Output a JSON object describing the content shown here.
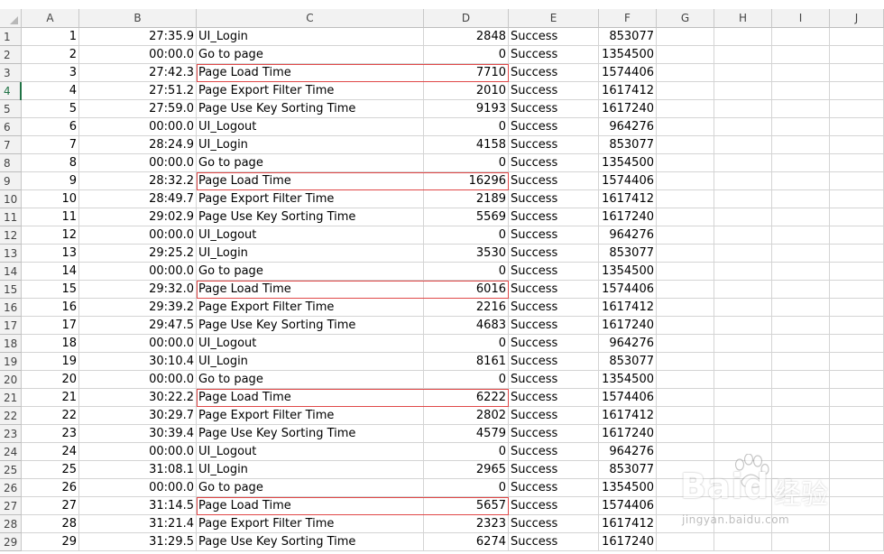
{
  "columns": [
    "A",
    "B",
    "C",
    "D",
    "E",
    "F",
    "G",
    "H",
    "I",
    "J"
  ],
  "rows": [
    {
      "n": "1",
      "a": "1",
      "b": "27:35.9",
      "c": "UI_Login",
      "d": "2848",
      "e": "Success",
      "f": "853077"
    },
    {
      "n": "2",
      "a": "2",
      "b": "00:00.0",
      "c": "Go to page",
      "d": "0",
      "e": "Success",
      "f": "1354500"
    },
    {
      "n": "3",
      "a": "3",
      "b": "27:42.3",
      "c": "Page Load Time",
      "d": "7710",
      "e": "Success",
      "f": "1574406",
      "hl": true
    },
    {
      "n": "4",
      "a": "4",
      "b": "27:51.2",
      "c": "Page Export Filter Time",
      "d": "2010",
      "e": "Success",
      "f": "1617412",
      "active": true
    },
    {
      "n": "5",
      "a": "5",
      "b": "27:59.0",
      "c": "Page Use Key Sorting Time",
      "d": "9193",
      "e": "Success",
      "f": "1617240"
    },
    {
      "n": "6",
      "a": "6",
      "b": "00:00.0",
      "c": "UI_Logout",
      "d": "0",
      "e": "Success",
      "f": "964276"
    },
    {
      "n": "7",
      "a": "7",
      "b": "28:24.9",
      "c": "UI_Login",
      "d": "4158",
      "e": "Success",
      "f": "853077"
    },
    {
      "n": "8",
      "a": "8",
      "b": "00:00.0",
      "c": "Go to page",
      "d": "0",
      "e": "Success",
      "f": "1354500"
    },
    {
      "n": "9",
      "a": "9",
      "b": "28:32.2",
      "c": "Page Load Time",
      "d": "16296",
      "e": "Success",
      "f": "1574406",
      "hl": true
    },
    {
      "n": "10",
      "a": "10",
      "b": "28:49.7",
      "c": "Page Export Filter Time",
      "d": "2189",
      "e": "Success",
      "f": "1617412"
    },
    {
      "n": "11",
      "a": "11",
      "b": "29:02.9",
      "c": "Page Use Key Sorting Time",
      "d": "5569",
      "e": "Success",
      "f": "1617240"
    },
    {
      "n": "12",
      "a": "12",
      "b": "00:00.0",
      "c": "UI_Logout",
      "d": "0",
      "e": "Success",
      "f": "964276"
    },
    {
      "n": "13",
      "a": "13",
      "b": "29:25.2",
      "c": "UI_Login",
      "d": "3530",
      "e": "Success",
      "f": "853077"
    },
    {
      "n": "14",
      "a": "14",
      "b": "00:00.0",
      "c": "Go to page",
      "d": "0",
      "e": "Success",
      "f": "1354500"
    },
    {
      "n": "15",
      "a": "15",
      "b": "29:32.0",
      "c": "Page Load Time",
      "d": "6016",
      "e": "Success",
      "f": "1574406",
      "hl": true
    },
    {
      "n": "16",
      "a": "16",
      "b": "29:39.2",
      "c": "Page Export Filter Time",
      "d": "2216",
      "e": "Success",
      "f": "1617412"
    },
    {
      "n": "17",
      "a": "17",
      "b": "29:47.5",
      "c": "Page Use Key Sorting Time",
      "d": "4683",
      "e": "Success",
      "f": "1617240"
    },
    {
      "n": "18",
      "a": "18",
      "b": "00:00.0",
      "c": "UI_Logout",
      "d": "0",
      "e": "Success",
      "f": "964276"
    },
    {
      "n": "19",
      "a": "19",
      "b": "30:10.4",
      "c": "UI_Login",
      "d": "8161",
      "e": "Success",
      "f": "853077"
    },
    {
      "n": "20",
      "a": "20",
      "b": "00:00.0",
      "c": "Go to page",
      "d": "0",
      "e": "Success",
      "f": "1354500"
    },
    {
      "n": "21",
      "a": "21",
      "b": "30:22.2",
      "c": "Page Load Time",
      "d": "6222",
      "e": "Success",
      "f": "1574406",
      "hl": true
    },
    {
      "n": "22",
      "a": "22",
      "b": "30:29.7",
      "c": "Page Export Filter Time",
      "d": "2802",
      "e": "Success",
      "f": "1617412"
    },
    {
      "n": "23",
      "a": "23",
      "b": "30:39.4",
      "c": "Page Use Key Sorting Time",
      "d": "4579",
      "e": "Success",
      "f": "1617240"
    },
    {
      "n": "24",
      "a": "24",
      "b": "00:00.0",
      "c": "UI_Logout",
      "d": "0",
      "e": "Success",
      "f": "964276"
    },
    {
      "n": "25",
      "a": "25",
      "b": "31:08.1",
      "c": "UI_Login",
      "d": "2965",
      "e": "Success",
      "f": "853077"
    },
    {
      "n": "26",
      "a": "26",
      "b": "00:00.0",
      "c": "Go to page",
      "d": "0",
      "e": "Success",
      "f": "1354500"
    },
    {
      "n": "27",
      "a": "27",
      "b": "31:14.5",
      "c": "Page Load Time",
      "d": "5657",
      "e": "Success",
      "f": "1574406",
      "hl": true
    },
    {
      "n": "28",
      "a": "28",
      "b": "31:21.4",
      "c": "Page Export Filter Time",
      "d": "2323",
      "e": "Success",
      "f": "1617412"
    },
    {
      "n": "29",
      "a": "29",
      "b": "31:29.5",
      "c": "Page Use Key Sorting Time",
      "d": "6274",
      "e": "Success",
      "f": "1617240"
    }
  ],
  "watermark": {
    "brand": "Baidu",
    "cn": "经验",
    "url": "jingyan.baidu.com"
  },
  "colors": {
    "highlight_border": "#e04848",
    "active_row": "#217346",
    "header_bg": "#f2f2f2",
    "gridline": "#d4d4d4"
  }
}
